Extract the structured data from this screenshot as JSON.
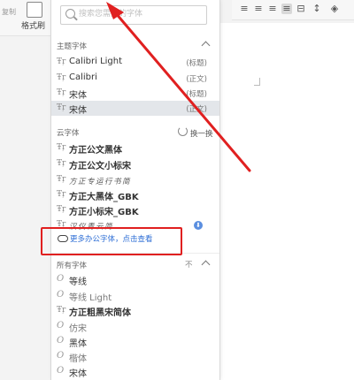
{
  "toolbar_left": {
    "copy_label": "复制",
    "format_painter_label": "格式刷"
  },
  "search": {
    "placeholder": "搜索您需要的字体"
  },
  "theme_fonts": {
    "title": "主题字体",
    "items": [
      {
        "name": "Calibri Light",
        "tag": "(标题)"
      },
      {
        "name": "Calibri",
        "tag": "(正文)"
      },
      {
        "name": "宋体",
        "tag": "(标题)"
      },
      {
        "name": "宋体",
        "tag": "(正文)"
      }
    ]
  },
  "cloud_fonts": {
    "title": "云字体",
    "refresh_label": "换一换",
    "items": [
      {
        "name": "方正公文黑体"
      },
      {
        "name": "方正公文小标宋"
      },
      {
        "name": "方正专运行书简"
      },
      {
        "name": "方正大黑体_GBK"
      },
      {
        "name": "方正小标宋_GBK"
      },
      {
        "name": "汉仪青云简"
      }
    ],
    "more_link": "更多办公字体，点击查看"
  },
  "all_fonts": {
    "title": "所有字体",
    "aux": "不",
    "items": [
      {
        "name": "等线"
      },
      {
        "name": "等线 Light"
      },
      {
        "name": "方正粗黑宋简体"
      },
      {
        "name": "仿宋"
      },
      {
        "name": "黑体"
      },
      {
        "name": "楷体"
      },
      {
        "name": "宋体"
      }
    ]
  },
  "colors": {
    "highlight": "#e02020",
    "link": "#2f6fd6",
    "arrow": "#e02020"
  }
}
